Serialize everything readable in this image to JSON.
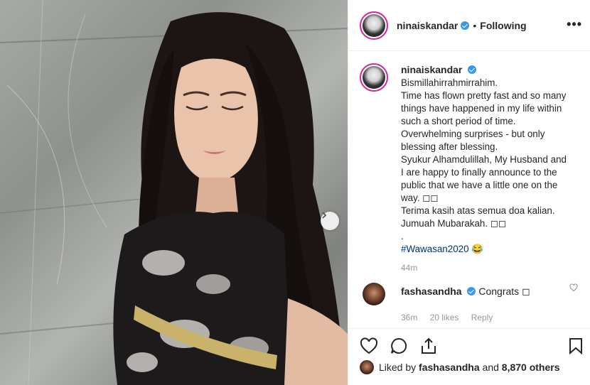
{
  "post": {
    "username": "ninaiskandar",
    "separator": "•",
    "follow_status": "Following",
    "more_label": "•••"
  },
  "caption": {
    "username": "ninaiskandar",
    "lines": [
      "Bismillahirrahmirrahim.",
      "Time has flown pretty fast and so many things have happened in my life within such a short period of time. Overwhelming surprises - but only blessing after blessing.",
      "Syukur Alhamdulillah, My Husband and I are happy to finally announce to the public that we have a little one on the way. ◻◻",
      "Terima kasih atas semua doa kalian. Jumuah Mubarakah. ◻◻",
      "."
    ],
    "hashtag": "#Wawasan2020",
    "emoji": "😂",
    "time": "44m"
  },
  "comment": {
    "username": "fashasandha",
    "text": "Congrats ◻",
    "time": "36m",
    "likes": "20 likes",
    "reply": "Reply"
  },
  "likes": {
    "liked_by_prefix": "Liked by",
    "user": "fashasandha",
    "and": "and",
    "count": "8,870 others"
  },
  "icons": {
    "heart": "heart-icon",
    "comment": "comment-icon",
    "share": "share-icon",
    "bookmark": "bookmark-icon",
    "next": "chevron-right-icon",
    "verified": "verified-badge-icon"
  },
  "colors": {
    "verified": "#3897f0",
    "hashtag": "#003569",
    "muted": "#999999",
    "story_ring": "#d6249f"
  }
}
